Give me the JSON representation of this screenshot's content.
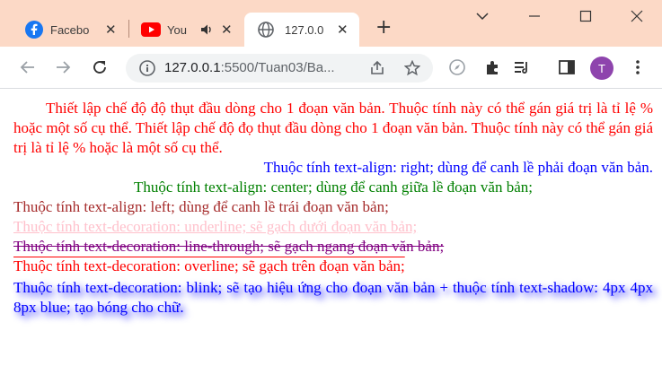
{
  "tabs": [
    {
      "label": "Facebo",
      "icon": "facebook-icon"
    },
    {
      "label": "You",
      "icon": "youtube-icon"
    },
    {
      "label": "127.0.0",
      "icon": "globe-icon"
    }
  ],
  "address_bar": {
    "host": "127.0.0.1",
    "path": ":5500/Tuan03/Ba..."
  },
  "profile": {
    "initial": "T"
  },
  "content": {
    "p1": "Thiết lập chế độ độ thụt đầu dòng cho 1 đoạn văn bản. Thuộc tính này có thể gán giá trị là tỉ lệ % hoặc một số cụ thể. Thiết lập chế độ đọ thụt đầu dòng cho 1 đoạn văn bản. Thuộc tính này có thể gán giá trị là tỉ lệ % hoặc là một số cụ thể.",
    "p2": "Thuộc tính text-align: right; dùng để canh lề phải đoạn văn bản.",
    "p3": "Thuộc tính text-align: center; dùng để canh giữa lề đoạn văn bản;",
    "p4": "Thuộc tính text-align: left; dùng để canh lề trái đoạn văn bản;",
    "p5": "Thuộc tính text-decoration: underline; sẽ gạch dưới đoạn văn bản;",
    "p6": "Thuộc tính text-decoration: line-through; sẽ gạch ngang đoạn văn bản;",
    "p7": "Thuộc tính text-decoration: overline; sẽ gạch trên đoạn văn bản;",
    "p8": "Thuộc tính text-decoration: blink; sẽ tạo hiệu ứng cho đoạn văn bản + thuộc tính text-shadow: 4px 4px 8px blue; tạo bóng cho chữ."
  },
  "colors": {
    "tab_strip": "#fcd9c6",
    "p1": "#ff0000",
    "p2": "#0000ff",
    "p3": "#008000",
    "p4": "#a52a2a",
    "p5": "#ffc0cb",
    "p6": "#800080",
    "p7": "#ff0000",
    "p8": "#0000ff"
  }
}
